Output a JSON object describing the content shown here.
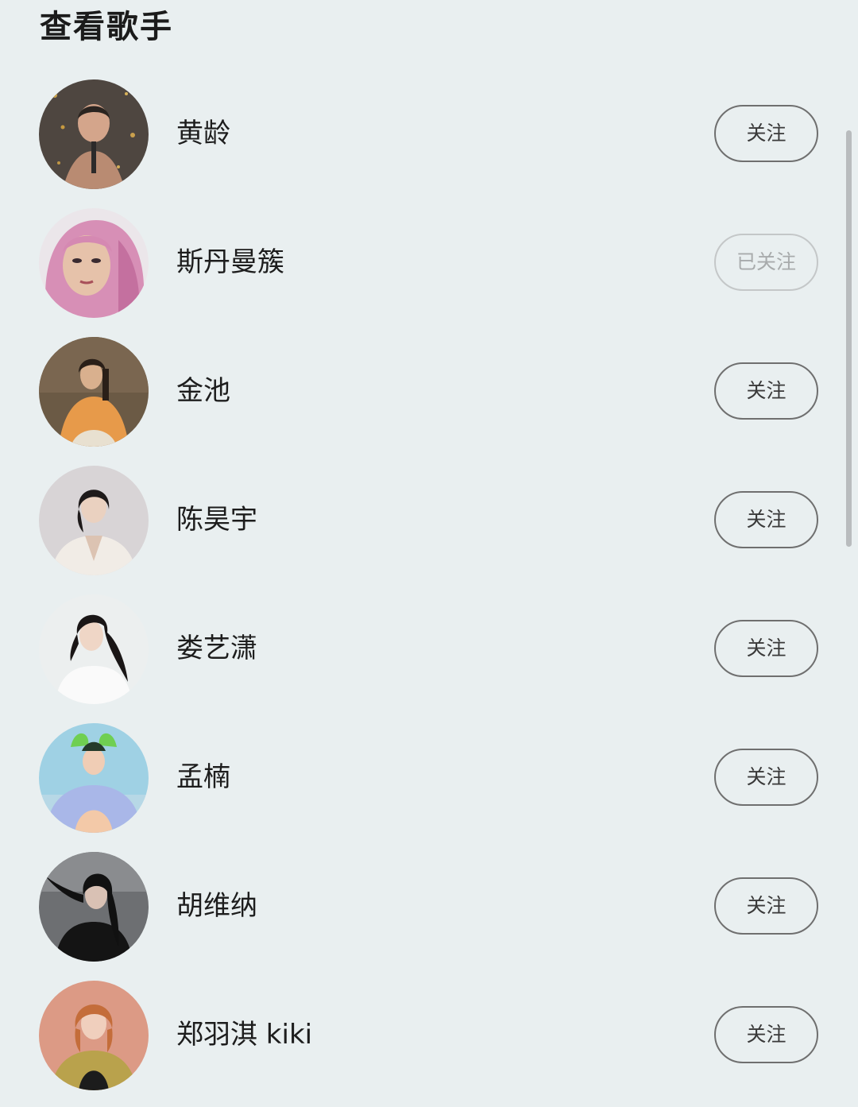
{
  "header": {
    "title": "查看歌手"
  },
  "singers": [
    {
      "name": "黄龄",
      "follow_label": "关注",
      "followed": false
    },
    {
      "name": "斯丹曼簇",
      "follow_label": "已关注",
      "followed": true
    },
    {
      "name": "金池",
      "follow_label": "关注",
      "followed": false
    },
    {
      "name": "陈昊宇",
      "follow_label": "关注",
      "followed": false
    },
    {
      "name": "娄艺潇",
      "follow_label": "关注",
      "followed": false
    },
    {
      "name": "孟楠",
      "follow_label": "关注",
      "followed": false
    },
    {
      "name": "胡维纳",
      "follow_label": "关注",
      "followed": false
    },
    {
      "name": "郑羽淇 kiki",
      "follow_label": "关注",
      "followed": false
    }
  ],
  "colors": {
    "background": "#e9eff0",
    "button_border": "#6f6f6f",
    "button_followed_border": "#c4c7c8",
    "scrollbar": "#b9bcbe"
  }
}
